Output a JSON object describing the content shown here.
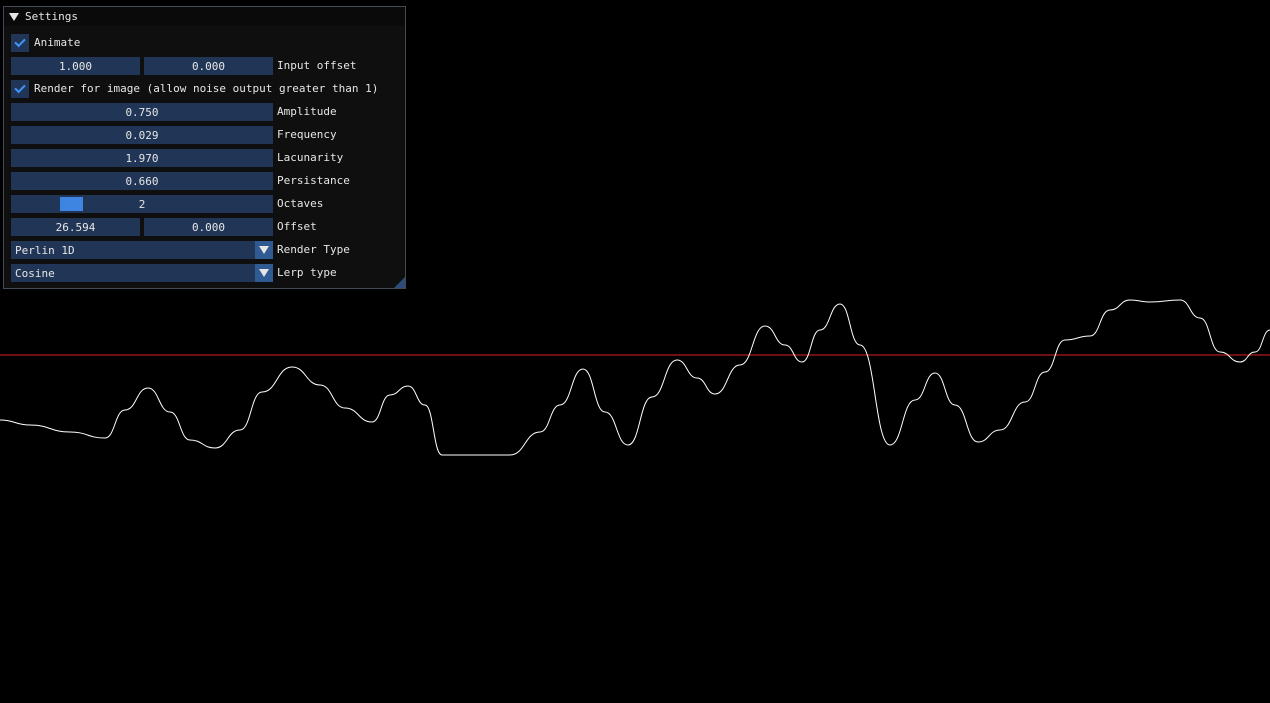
{
  "settings": {
    "title": "Settings",
    "animate": {
      "label": "Animate",
      "checked": true
    },
    "input_offset": {
      "values": [
        "1.000",
        "0.000"
      ],
      "label": "Input offset"
    },
    "render_for_image": {
      "label": "Render for image (allow noise output greater than 1)",
      "checked": true
    },
    "amplitude": {
      "value": "0.750",
      "label": "Amplitude"
    },
    "frequency": {
      "value": "0.029",
      "label": "Frequency"
    },
    "lacunarity": {
      "value": "1.970",
      "label": "Lacunarity"
    },
    "persistance": {
      "value": "0.660",
      "label": "Persistance"
    },
    "octaves": {
      "value": "2",
      "label": "Octaves"
    },
    "offset": {
      "values": [
        "26.594",
        "0.000"
      ],
      "label": "Offset"
    },
    "render_type": {
      "value": "Perlin 1D",
      "label": "Render Type"
    },
    "lerp_type": {
      "value": "Cosine",
      "label": "Lerp type"
    }
  },
  "colors": {
    "panel_bg": "#101010",
    "frame_bg": "#213656",
    "accent": "#4296fa",
    "baseline": "#e02020",
    "noise_line": "#ffffff"
  }
}
